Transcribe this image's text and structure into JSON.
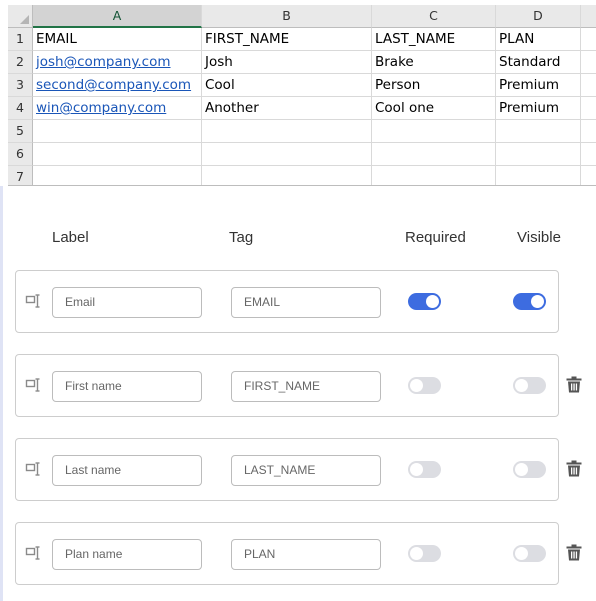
{
  "sheet": {
    "col_headers": [
      "A",
      "B",
      "C",
      "D"
    ],
    "row_numbers": [
      "1",
      "2",
      "3",
      "4",
      "5",
      "6",
      "7"
    ],
    "rows": [
      [
        "EMAIL",
        "FIRST_NAME",
        "LAST_NAME",
        "PLAN"
      ],
      [
        "josh@company.com",
        "Josh",
        "Brake",
        "Standard"
      ],
      [
        "second@company.com",
        "Cool",
        "Person",
        "Premium"
      ],
      [
        "win@company.com",
        "Another",
        "Cool one",
        "Premium"
      ],
      [
        "",
        "",
        "",
        ""
      ],
      [
        "",
        "",
        "",
        ""
      ],
      [
        "",
        "",
        "",
        ""
      ]
    ]
  },
  "mapping": {
    "headers": {
      "label": "Label",
      "tag": "Tag",
      "required": "Required",
      "visible": "Visible"
    },
    "fields": [
      {
        "label_placeholder": "Email",
        "tag_value": "EMAIL",
        "required": true,
        "visible": true,
        "deletable": false
      },
      {
        "label_placeholder": "First name",
        "tag_value": "FIRST_NAME",
        "required": false,
        "visible": false,
        "deletable": true
      },
      {
        "label_placeholder": "Last name",
        "tag_value": "LAST_NAME",
        "required": false,
        "visible": false,
        "deletable": true
      },
      {
        "label_placeholder": "Plan name",
        "tag_value": "PLAN",
        "required": false,
        "visible": false,
        "deletable": true
      }
    ]
  },
  "icons": {
    "drag": "drag-handle-icon",
    "delete": "trash-icon"
  },
  "colors": {
    "toggle_on": "#3d6ce0",
    "toggle_off": "#dcdde2",
    "link": "#1a56b8",
    "sheet_active_col": "#217346"
  }
}
